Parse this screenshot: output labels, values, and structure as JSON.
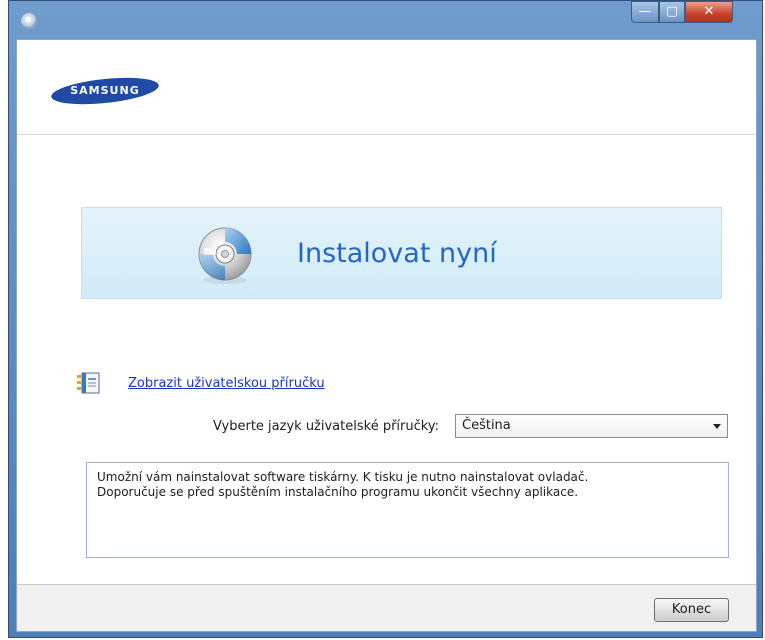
{
  "window": {
    "controls": {
      "minimize": "—",
      "maximize": "▢",
      "close": "✕"
    }
  },
  "header": {
    "logo_text": "SAMSUNG",
    "logo_color": "#1f4aa5"
  },
  "install": {
    "label": "Instalovat nyní",
    "icon": "cd-icon",
    "accent": "#2366c4"
  },
  "manual": {
    "link_label": "Zobrazit uživatelskou příručku",
    "icon": "manual-icon"
  },
  "language": {
    "label": "Vyberte jazyk uživatelské příručky:",
    "selected": "Čeština"
  },
  "description": {
    "line1": "Umožní vám nainstalovat software tiskárny. K tisku je nutno nainstalovat ovladač.",
    "line2": "Doporučuje se před spuštěním instalačního programu ukončit všechny aplikace."
  },
  "footer": {
    "close_label": "Konec"
  }
}
